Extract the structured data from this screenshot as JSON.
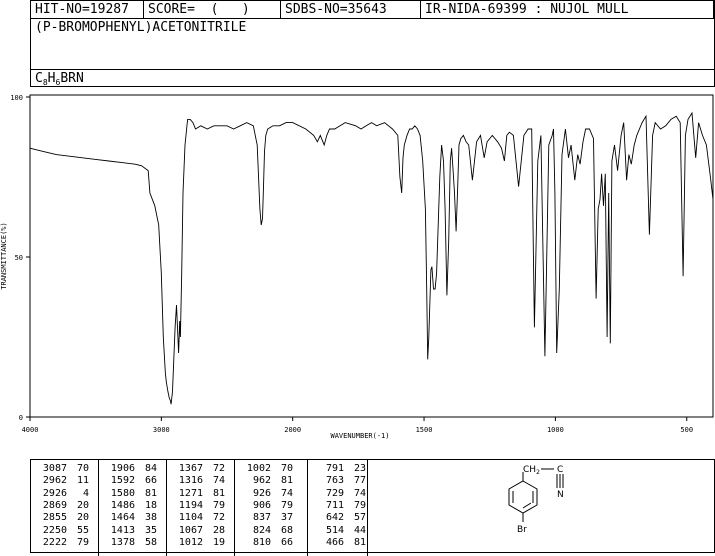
{
  "header": {
    "hit_no": "HIT-NO=19287",
    "score": "SCORE=  (   )",
    "sdbs_no": "SDBS-NO=35643",
    "ir_nida": "IR-NIDA-69399 : NUJOL MULL"
  },
  "compound": {
    "name": "(P-BROMOPHENYL)ACETONITRILE",
    "formula_parts": [
      "C",
      "8",
      "H",
      "6",
      "BRN"
    ]
  },
  "chart_data": {
    "type": "line",
    "xlabel": "WAVENUMBER(-1)",
    "ylabel": "TRANSMITTANCE(%)",
    "xlim": [
      4000,
      400
    ],
    "ylim": [
      0,
      100
    ],
    "x_ticks": [
      4000,
      3000,
      2000,
      1500,
      1000,
      500
    ],
    "y_ticks": [
      0,
      50,
      100
    ],
    "series": [
      {
        "x": [
          4000,
          3900,
          3800,
          3700,
          3600,
          3500,
          3400,
          3300,
          3200,
          3150,
          3100,
          3087,
          3050,
          3020,
          3000,
          2985,
          2970,
          2962,
          2950,
          2940,
          2930,
          2926,
          2915,
          2905,
          2895,
          2885,
          2869,
          2860,
          2855,
          2845,
          2835,
          2820,
          2800,
          2780,
          2760,
          2740,
          2700,
          2650,
          2600,
          2550,
          2500,
          2450,
          2400,
          2350,
          2300,
          2270,
          2250,
          2240,
          2230,
          2222,
          2215,
          2205,
          2190,
          2150,
          2100,
          2050,
          2000,
          1950,
          1920,
          1906,
          1895,
          1880,
          1870,
          1860,
          1840,
          1800,
          1760,
          1740,
          1720,
          1700,
          1680,
          1650,
          1620,
          1600,
          1592,
          1585,
          1580,
          1575,
          1565,
          1555,
          1545,
          1535,
          1525,
          1515,
          1505,
          1495,
          1490,
          1486,
          1482,
          1478,
          1474,
          1470,
          1464,
          1458,
          1452,
          1446,
          1440,
          1433,
          1426,
          1420,
          1413,
          1406,
          1400,
          1395,
          1390,
          1384,
          1378,
          1372,
          1367,
          1360,
          1350,
          1340,
          1330,
          1316,
          1300,
          1285,
          1271,
          1260,
          1240,
          1220,
          1205,
          1194,
          1185,
          1175,
          1160,
          1140,
          1120,
          1104,
          1090,
          1080,
          1067,
          1055,
          1040,
          1025,
          1012,
          1007,
          1002,
          995,
          985,
          975,
          962,
          950,
          940,
          926,
          915,
          906,
          895,
          885,
          870,
          855,
          845,
          837,
          830,
          824,
          817,
          810,
          803,
          797,
          791,
          785,
          775,
          763,
          750,
          740,
          729,
          720,
          711,
          700,
          690,
          670,
          655,
          642,
          630,
          620,
          600,
          580,
          560,
          540,
          525,
          514,
          505,
          495,
          480,
          466,
          455,
          440,
          425,
          410,
          400
        ],
        "y": [
          84,
          83,
          82,
          81.5,
          81,
          80.5,
          80,
          79.5,
          79,
          78.5,
          77,
          70,
          66,
          60,
          45,
          25,
          14,
          11,
          8,
          6,
          5,
          4,
          8,
          18,
          28,
          35,
          20,
          30,
          25,
          45,
          70,
          85,
          93,
          93,
          92,
          90,
          91,
          90,
          91,
          91,
          91,
          90,
          91,
          92,
          91,
          85,
          65,
          60,
          62,
          72,
          83,
          88,
          90,
          91,
          91,
          92,
          92,
          90,
          88,
          86,
          88,
          85,
          88,
          90,
          90,
          92,
          91,
          90,
          91,
          92,
          91,
          92,
          90,
          88,
          75,
          70,
          81,
          85,
          88,
          90,
          90,
          91,
          90,
          88,
          80,
          65,
          40,
          18,
          25,
          35,
          46,
          47,
          40,
          40,
          45,
          60,
          75,
          85,
          80,
          65,
          38,
          55,
          80,
          84,
          78,
          70,
          58,
          72,
          85,
          87,
          88,
          86,
          85,
          74,
          86,
          88,
          81,
          86,
          88,
          86,
          84,
          80,
          88,
          89,
          88,
          72,
          88,
          90,
          90,
          28,
          80,
          88,
          19,
          85,
          88,
          90,
          70,
          20,
          40,
          82,
          90,
          81,
          85,
          74,
          82,
          79,
          86,
          90,
          90,
          87,
          37,
          65,
          68,
          76,
          66,
          76,
          25,
          70,
          23,
          80,
          85,
          77,
          88,
          92,
          74,
          82,
          79,
          85,
          88,
          92,
          94,
          57,
          88,
          92,
          90,
          91,
          93,
          94,
          92,
          44,
          88,
          93,
          95,
          81,
          92,
          88,
          85,
          75,
          68
        ]
      }
    ]
  },
  "peak_table": [
    [
      [
        "3087",
        "70"
      ],
      [
        "2962",
        "11"
      ],
      [
        "2926",
        "4"
      ],
      [
        "2869",
        "20"
      ],
      [
        "2855",
        "20"
      ],
      [
        "2250",
        "55"
      ],
      [
        "2222",
        "79"
      ]
    ],
    [
      [
        "1906",
        "84"
      ],
      [
        "1592",
        "66"
      ],
      [
        "1580",
        "81"
      ],
      [
        "1486",
        "18"
      ],
      [
        "1464",
        "38"
      ],
      [
        "1413",
        "35"
      ],
      [
        "1378",
        "58"
      ]
    ],
    [
      [
        "1367",
        "72"
      ],
      [
        "1316",
        "74"
      ],
      [
        "1271",
        "81"
      ],
      [
        "1194",
        "79"
      ],
      [
        "1104",
        "72"
      ],
      [
        "1067",
        "28"
      ],
      [
        "1012",
        "19"
      ]
    ],
    [
      [
        "1002",
        "70"
      ],
      [
        "962",
        "81"
      ],
      [
        "926",
        "74"
      ],
      [
        "906",
        "79"
      ],
      [
        "837",
        "37"
      ],
      [
        "824",
        "68"
      ],
      [
        "810",
        "66"
      ]
    ],
    [
      [
        "791",
        "23"
      ],
      [
        "763",
        "77"
      ],
      [
        "729",
        "74"
      ],
      [
        "711",
        "79"
      ],
      [
        "642",
        "57"
      ],
      [
        "514",
        "44"
      ],
      [
        "466",
        "81"
      ]
    ]
  ],
  "structure": {
    "ch2_label": "CH",
    "ch2_sub": "2",
    "c_label": "C",
    "n_label": "N",
    "br_label": "Br"
  }
}
